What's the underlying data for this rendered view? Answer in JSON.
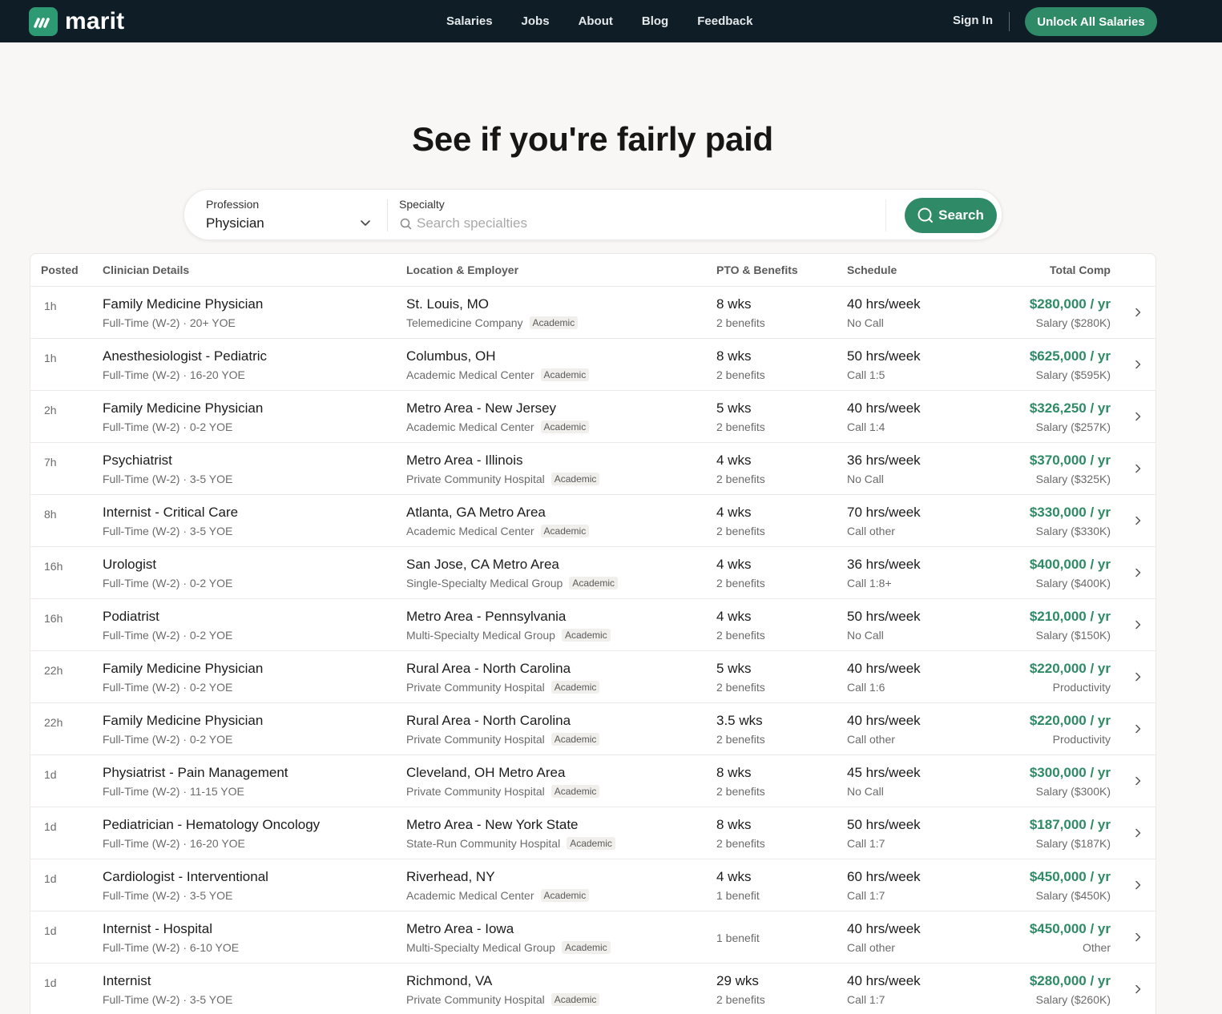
{
  "brand": {
    "name": "marit",
    "color": "#2e9a73"
  },
  "nav": {
    "links": [
      "Salaries",
      "Jobs",
      "About",
      "Blog",
      "Feedback"
    ],
    "sign_in": "Sign In",
    "cta": "Unlock All Salaries"
  },
  "hero": {
    "title": "See if you're fairly paid"
  },
  "search": {
    "profession_label": "Profession",
    "profession_value": "Physician",
    "specialty_label": "Specialty",
    "specialty_placeholder": "Search specialties",
    "button": "Search"
  },
  "table": {
    "headers": {
      "posted": "Posted",
      "clinician": "Clinician Details",
      "location": "Location & Employer",
      "pto": "PTO & Benefits",
      "schedule": "Schedule",
      "comp": "Total Comp"
    },
    "rows": [
      {
        "posted": "1h",
        "title": "Family Medicine Physician",
        "details": "Full-Time (W-2) · 20+ YOE",
        "location": "St. Louis, MO",
        "employer": "Telemedicine Company",
        "badge": "Academic",
        "pto": "8 wks",
        "benefits": "2 benefits",
        "hours": "40 hrs/week",
        "call": "No Call",
        "comp": "$280,000 / yr",
        "comp_type": "Salary ($280K)"
      },
      {
        "posted": "1h",
        "title": "Anesthesiologist - Pediatric",
        "details": "Full-Time (W-2) · 16-20 YOE",
        "location": "Columbus, OH",
        "employer": "Academic Medical Center",
        "badge": "Academic",
        "pto": "8 wks",
        "benefits": "2 benefits",
        "hours": "50 hrs/week",
        "call": "Call 1:5",
        "comp": "$625,000 / yr",
        "comp_type": "Salary ($595K)"
      },
      {
        "posted": "2h",
        "title": "Family Medicine Physician",
        "details": "Full-Time (W-2) · 0-2 YOE",
        "location": "Metro Area - New Jersey",
        "employer": "Academic Medical Center",
        "badge": "Academic",
        "pto": "5 wks",
        "benefits": "2 benefits",
        "hours": "40 hrs/week",
        "call": "Call 1:4",
        "comp": "$326,250 / yr",
        "comp_type": "Salary ($257K)"
      },
      {
        "posted": "7h",
        "title": "Psychiatrist",
        "details": "Full-Time (W-2) · 3-5 YOE",
        "location": "Metro Area - Illinois",
        "employer": "Private Community Hospital",
        "badge": "Academic",
        "pto": "4 wks",
        "benefits": "2 benefits",
        "hours": "36 hrs/week",
        "call": "No Call",
        "comp": "$370,000 / yr",
        "comp_type": "Salary ($325K)"
      },
      {
        "posted": "8h",
        "title": "Internist - Critical Care",
        "details": "Full-Time (W-2) · 3-5 YOE",
        "location": "Atlanta, GA Metro Area",
        "employer": "Academic Medical Center",
        "badge": "Academic",
        "pto": "4 wks",
        "benefits": "2 benefits",
        "hours": "70 hrs/week",
        "call": "Call other",
        "comp": "$330,000 / yr",
        "comp_type": "Salary ($330K)"
      },
      {
        "posted": "16h",
        "title": "Urologist",
        "details": "Full-Time (W-2) · 0-2 YOE",
        "location": "San Jose, CA Metro Area",
        "employer": "Single-Specialty Medical Group",
        "badge": "Academic",
        "pto": "4 wks",
        "benefits": "2 benefits",
        "hours": "36 hrs/week",
        "call": "Call 1:8+",
        "comp": "$400,000 / yr",
        "comp_type": "Salary ($400K)"
      },
      {
        "posted": "16h",
        "title": "Podiatrist",
        "details": "Full-Time (W-2) · 0-2 YOE",
        "location": "Metro Area - Pennsylvania",
        "employer": "Multi-Specialty Medical Group",
        "badge": "Academic",
        "pto": "4 wks",
        "benefits": "2 benefits",
        "hours": "50 hrs/week",
        "call": "No Call",
        "comp": "$210,000 / yr",
        "comp_type": "Salary ($150K)"
      },
      {
        "posted": "22h",
        "title": "Family Medicine Physician",
        "details": "Full-Time (W-2) · 0-2 YOE",
        "location": "Rural Area - North Carolina",
        "employer": "Private Community Hospital",
        "badge": "Academic",
        "pto": "5 wks",
        "benefits": "2 benefits",
        "hours": "40 hrs/week",
        "call": "Call 1:6",
        "comp": "$220,000 / yr",
        "comp_type": "Productivity"
      },
      {
        "posted": "22h",
        "title": "Family Medicine Physician",
        "details": "Full-Time (W-2) · 0-2 YOE",
        "location": "Rural Area - North Carolina",
        "employer": "Private Community Hospital",
        "badge": "Academic",
        "pto": "3.5 wks",
        "benefits": "2 benefits",
        "hours": "40 hrs/week",
        "call": "Call other",
        "comp": "$220,000 / yr",
        "comp_type": "Productivity"
      },
      {
        "posted": "1d",
        "title": "Physiatrist - Pain Management",
        "details": "Full-Time (W-2) · 11-15 YOE",
        "location": "Cleveland, OH Metro Area",
        "employer": "Private Community Hospital",
        "badge": "Academic",
        "pto": "8 wks",
        "benefits": "2 benefits",
        "hours": "45 hrs/week",
        "call": "No Call",
        "comp": "$300,000 / yr",
        "comp_type": "Salary ($300K)"
      },
      {
        "posted": "1d",
        "title": "Pediatrician - Hematology Oncology",
        "details": "Full-Time (W-2) · 16-20 YOE",
        "location": "Metro Area - New York State",
        "employer": "State-Run Community Hospital",
        "badge": "Academic",
        "pto": "8 wks",
        "benefits": "2 benefits",
        "hours": "50 hrs/week",
        "call": "Call 1:7",
        "comp": "$187,000 / yr",
        "comp_type": "Salary ($187K)"
      },
      {
        "posted": "1d",
        "title": "Cardiologist - Interventional",
        "details": "Full-Time (W-2) · 3-5 YOE",
        "location": "Riverhead, NY",
        "employer": "Academic Medical Center",
        "badge": "Academic",
        "pto": "4 wks",
        "benefits": "1 benefit",
        "hours": "60 hrs/week",
        "call": "Call 1:7",
        "comp": "$450,000 / yr",
        "comp_type": "Salary ($450K)"
      },
      {
        "posted": "1d",
        "title": "Internist - Hospital",
        "details": "Full-Time (W-2) · 6-10 YOE",
        "location": "Metro Area - Iowa",
        "employer": "Multi-Specialty Medical Group",
        "badge": "Academic",
        "pto": "",
        "benefits": "1 benefit",
        "hours": "40 hrs/week",
        "call": "Call other",
        "comp": "$450,000 / yr",
        "comp_type": "Other"
      },
      {
        "posted": "1d",
        "title": "Internist",
        "details": "Full-Time (W-2) · 3-5 YOE",
        "location": "Richmond, VA",
        "employer": "Private Community Hospital",
        "badge": "Academic",
        "pto": "29 wks",
        "benefits": "2 benefits",
        "hours": "40 hrs/week",
        "call": "Call 1:7",
        "comp": "$280,000 / yr",
        "comp_type": "Salary ($260K)"
      }
    ]
  }
}
